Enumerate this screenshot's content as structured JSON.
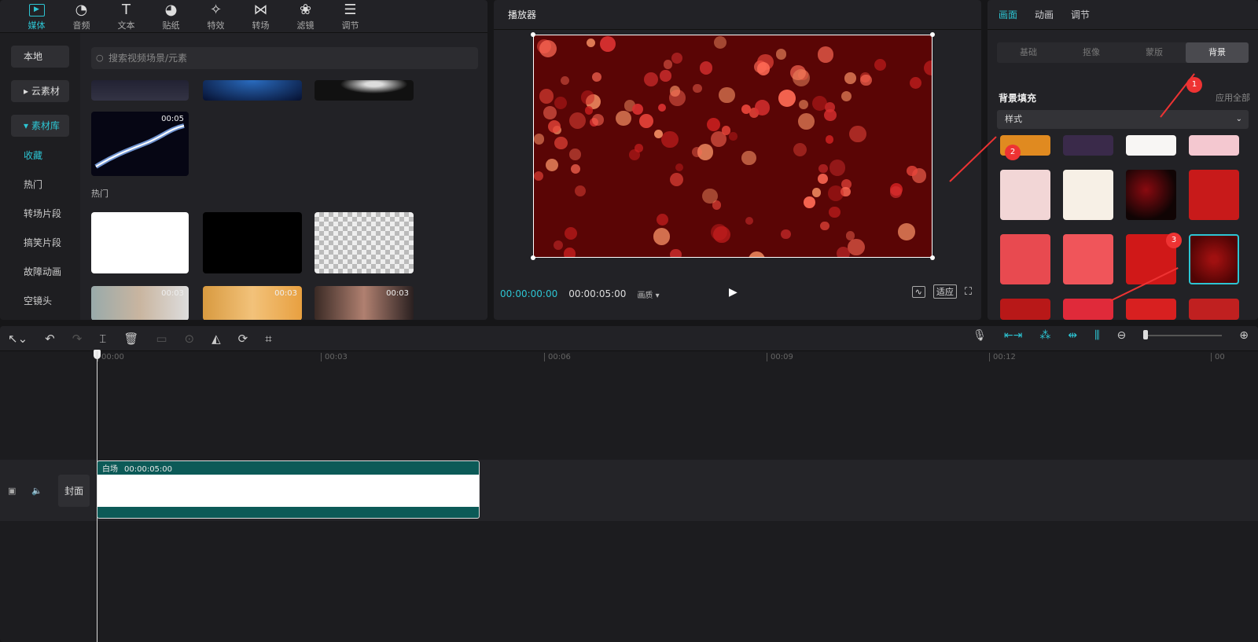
{
  "media": {
    "nav": [
      {
        "label": "媒体",
        "icon": "media-icon"
      },
      {
        "label": "音频",
        "icon": "audio-icon"
      },
      {
        "label": "文本",
        "icon": "text-icon"
      },
      {
        "label": "贴纸",
        "icon": "sticker-icon"
      },
      {
        "label": "特效",
        "icon": "effects-icon"
      },
      {
        "label": "转场",
        "icon": "transition-icon"
      },
      {
        "label": "滤镜",
        "icon": "filter-icon"
      },
      {
        "label": "调节",
        "icon": "adjust-icon"
      }
    ],
    "sidebar": {
      "local": "本地",
      "cloud": "云素材",
      "library": "素材库",
      "subs": [
        "收藏",
        "热门",
        "转场片段",
        "搞笑片段",
        "故障动画",
        "空镜头"
      ]
    },
    "search_placeholder": "搜索视频场景/元素",
    "thumb_duration": "00:05",
    "section_hot": "热门",
    "face_durations": [
      "00:03",
      "00:03",
      "00:03"
    ]
  },
  "player": {
    "title": "播放器",
    "timecode_current": "00:00:00:00",
    "timecode_total": "00:00:05:00",
    "quality": "画质",
    "fit": "适应"
  },
  "inspector": {
    "tabs": [
      "画面",
      "动画",
      "调节"
    ],
    "segments": [
      "基础",
      "抠像",
      "蒙版",
      "背景"
    ],
    "bg_fill": "背景填充",
    "apply_all": "应用全部",
    "style_value": "样式",
    "badges": [
      "1",
      "2",
      "3"
    ]
  },
  "timeline": {
    "ruler": [
      "00:00",
      "00:03",
      "00:06",
      "00:09",
      "00:12",
      "00"
    ],
    "cover": "封面",
    "clip_name": "白场",
    "clip_duration": "00:00:05:00"
  },
  "colors": {
    "accent": "#2dc5d3",
    "annotation": "#e33333",
    "clip": "#0c5a57"
  }
}
